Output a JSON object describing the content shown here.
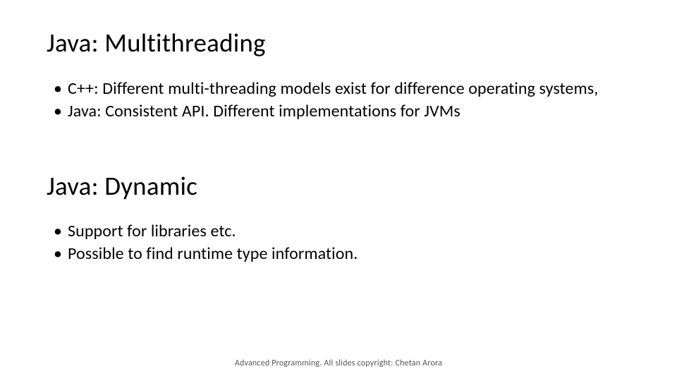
{
  "sections": [
    {
      "heading": "Java: Multithreading",
      "bullets": [
        "C++: Different multi-threading models exist for difference operating systems,",
        "Java: Consistent API. Different implementations for JVMs"
      ]
    },
    {
      "heading": "Java: Dynamic",
      "bullets": [
        "Support for libraries etc.",
        "Possible to find runtime type information."
      ]
    }
  ],
  "footer": "Advanced Programming. All slides copyright: Chetan Arora"
}
